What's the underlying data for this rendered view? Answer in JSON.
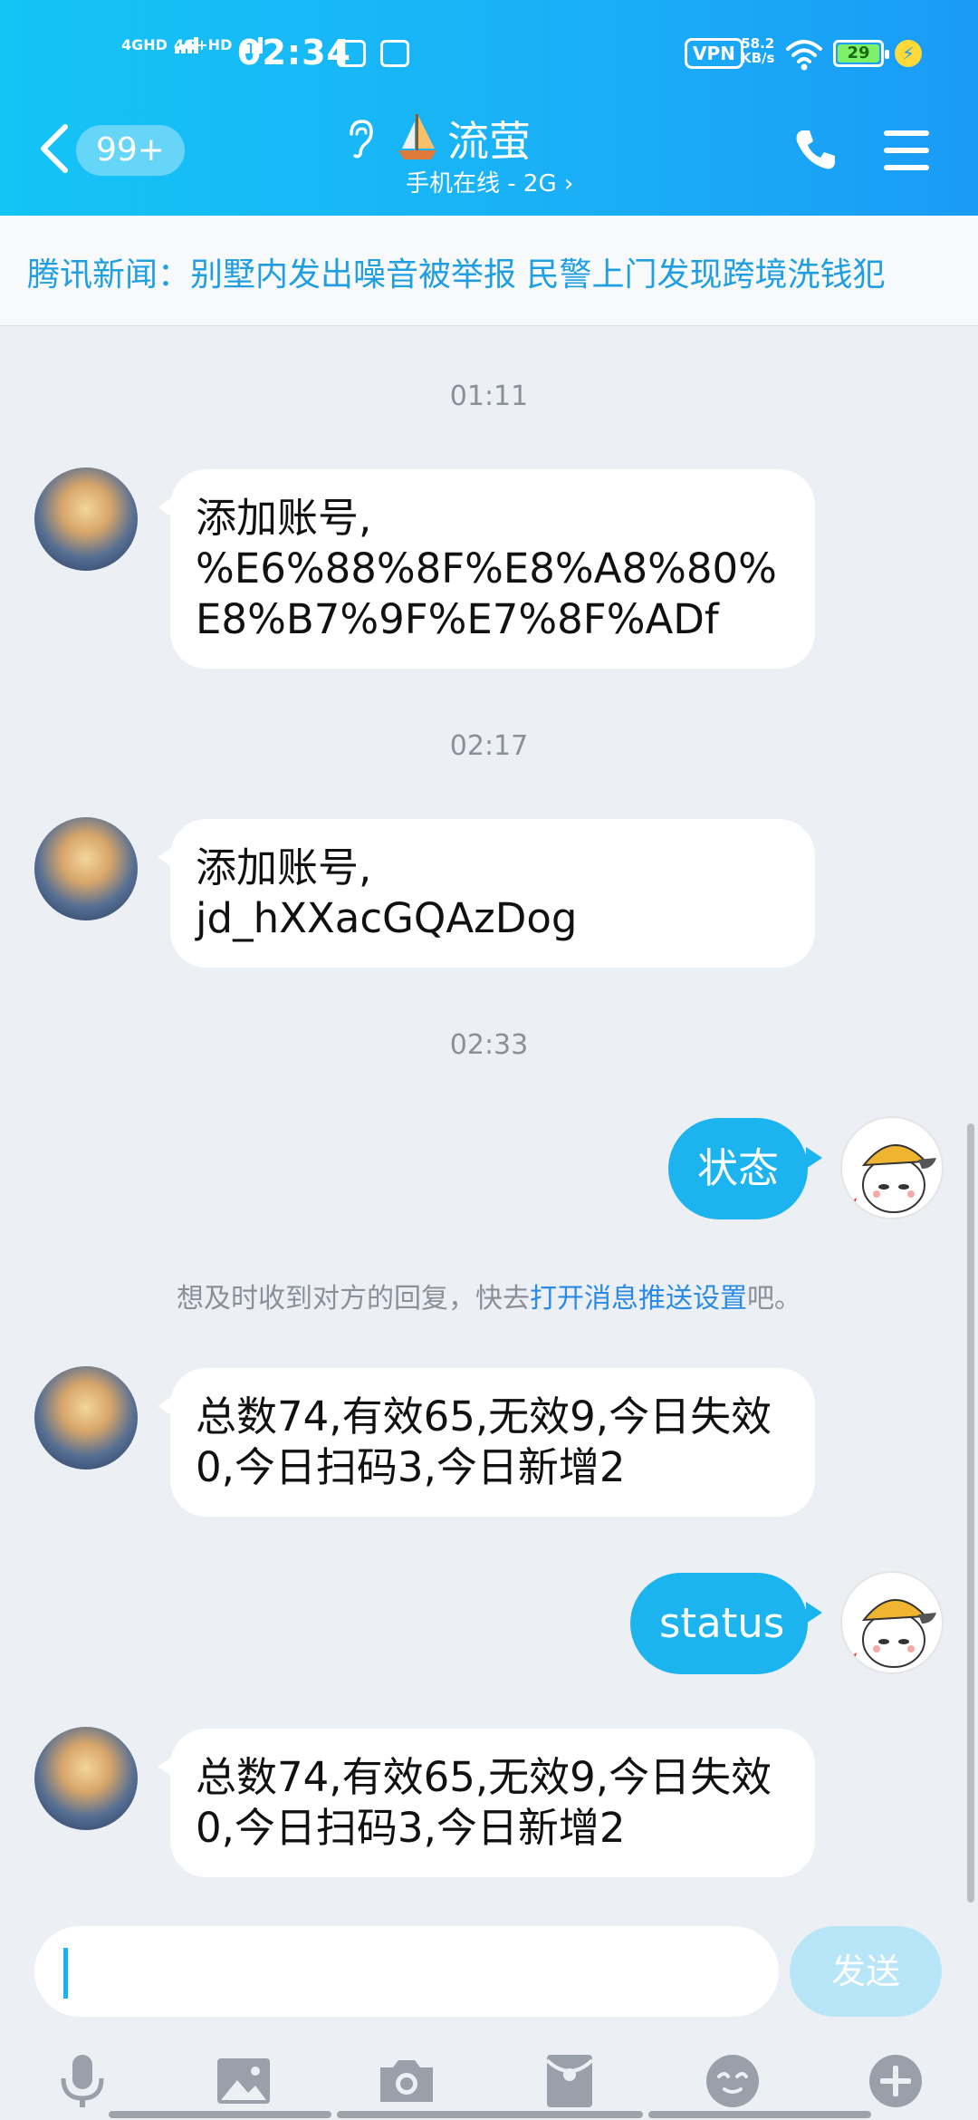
{
  "statusbar": {
    "signal1": "4GHD",
    "signal2": "4G+HD",
    "time": "02:34",
    "vpn": "VPN",
    "speed_value": "58.2",
    "speed_unit": "KB/s",
    "battery": "29"
  },
  "header": {
    "unread_count": "99+",
    "contact_name": "流萤",
    "contact_status": "手机在线 - 2G ›"
  },
  "news": {
    "text": "腾讯新闻：别墅内发出噪音被举报 民警上门发现跨境洗钱犯"
  },
  "chat": {
    "time1": "01:11",
    "msg1": "添加账号,\n%E6%88%8F%E8%A8%80%E8%B7%9F%E7%8F%ADf",
    "time2": "02:17",
    "msg2": "添加账号,\njd_hXXacGQAzDog",
    "time3": "02:33",
    "msg3": "状态",
    "notice_prefix": "想及时收到对方的回复，快去",
    "notice_link": "打开消息推送设置",
    "notice_suffix": "吧。",
    "msg4": "总数74,有效65,无效9,今日失效0,今日扫码3,今日新增2",
    "msg5": "status",
    "msg6": "总数74,有效65,无效9,今日失效0,今日扫码3,今日新增2"
  },
  "input": {
    "value": "",
    "send_label": "发送"
  },
  "colors": {
    "accent": "#1cb4ef",
    "header_start": "#14c4f5",
    "header_end": "#1a9bf6",
    "link": "#2a8be6"
  },
  "icons": [
    "back-arrow-icon",
    "ear-icon",
    "sailboat-icon",
    "phone-icon",
    "menu-icon",
    "microphone-icon",
    "image-icon",
    "camera-icon",
    "red-packet-icon",
    "emoji-icon",
    "plus-icon"
  ]
}
